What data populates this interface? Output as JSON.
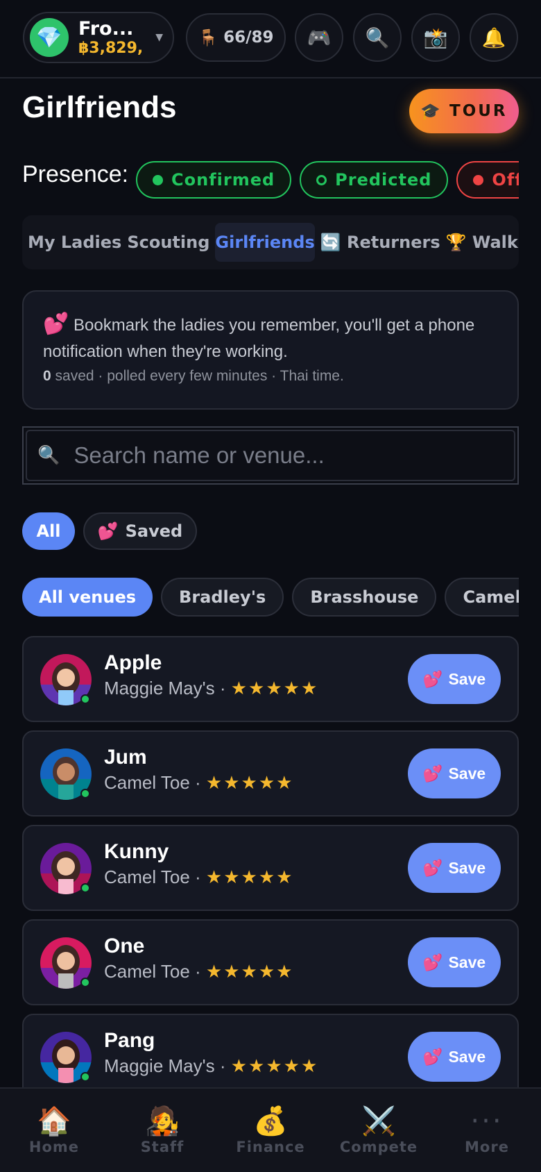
{
  "account": {
    "name": "Fro...",
    "balance": "฿3,829,",
    "gem_icon": "gem-icon"
  },
  "header": {
    "seats_icon": "chair-icon",
    "seats": "66/89",
    "icons": [
      "gamepad-icon",
      "search-icon",
      "camera-icon",
      "bell-icon"
    ]
  },
  "page": {
    "title": "Girlfriends",
    "tour_label": "TOUR",
    "tour_icon": "graduation-cap-icon"
  },
  "presence": {
    "label": "Presence:",
    "chips": [
      {
        "label": "Confirmed",
        "color": "#22c55e"
      },
      {
        "label": "Predicted",
        "color": "#22c55e"
      },
      {
        "label": "Offline",
        "color": "#ef4444"
      }
    ]
  },
  "tabs": [
    {
      "label": "My Ladies",
      "active": false
    },
    {
      "label": "Scouting",
      "active": false
    },
    {
      "label": "Girlfriends",
      "active": true
    },
    {
      "label": "🔄 Returners",
      "active": false
    },
    {
      "label": "🏆 Walk of",
      "active": false
    }
  ],
  "info": {
    "emoji": "💕",
    "text": "Bookmark the ladies you remember, you'll get a phone notification when they're working.",
    "saved_count": "0",
    "sub": "saved · polled every few minutes · Thai time."
  },
  "search": {
    "placeholder": "Search name or venue..."
  },
  "filters": {
    "all": "All",
    "saved": "Saved",
    "saved_emoji": "💕"
  },
  "venues": [
    "All venues",
    "Bradley's",
    "Brasshouse",
    "Camel Toe"
  ],
  "girls": [
    {
      "name": "Apple",
      "venue": "Maggie May's",
      "stars": "★★★★★",
      "save": "Save"
    },
    {
      "name": "Jum",
      "venue": "Camel Toe",
      "stars": "★★★★★",
      "save": "Save"
    },
    {
      "name": "Kunny",
      "venue": "Camel Toe",
      "stars": "★★★★★",
      "save": "Save"
    },
    {
      "name": "One",
      "venue": "Camel Toe",
      "stars": "★★★★★",
      "save": "Save"
    },
    {
      "name": "Pang",
      "venue": "Maggie May's",
      "stars": "★★★★★",
      "save": "Save"
    }
  ],
  "nav": [
    {
      "label": "Home",
      "icon": "🏠"
    },
    {
      "label": "Staff",
      "icon": "🧑‍🎤"
    },
    {
      "label": "Finance",
      "icon": "💰"
    },
    {
      "label": "Compete",
      "icon": "⚔️"
    },
    {
      "label": "More",
      "icon": "···"
    }
  ],
  "colors": {
    "accent": "#5b86f5",
    "online": "#22c55e",
    "star": "#f5b82e",
    "background": "#0b0d14"
  }
}
